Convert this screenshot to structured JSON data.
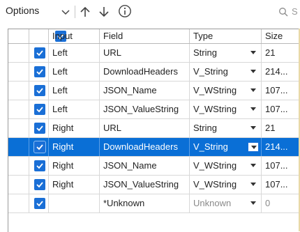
{
  "toolbar": {
    "options_label": "Options",
    "search_text": "S"
  },
  "columns": [
    "Input",
    "Field",
    "Type",
    "Size"
  ],
  "rows": [
    {
      "input": "Left",
      "field": "URL",
      "type": "String",
      "size": "21",
      "checked": true
    },
    {
      "input": "Left",
      "field": "DownloadHeaders",
      "type": "V_String",
      "size": "214...",
      "checked": true
    },
    {
      "input": "Left",
      "field": "JSON_Name",
      "type": "V_WString",
      "size": "107...",
      "checked": true
    },
    {
      "input": "Left",
      "field": "JSON_ValueString",
      "type": "V_WString",
      "size": "107...",
      "checked": true
    },
    {
      "input": "Right",
      "field": "URL",
      "type": "String",
      "size": "21",
      "checked": true
    },
    {
      "input": "Right",
      "field": "DownloadHeaders",
      "type": "V_String",
      "size": "214...",
      "checked": true,
      "selected": true
    },
    {
      "input": "Right",
      "field": "JSON_Name",
      "type": "V_WString",
      "size": "107...",
      "checked": true
    },
    {
      "input": "Right",
      "field": "JSON_ValueString",
      "type": "V_WString",
      "size": "107...",
      "checked": true
    },
    {
      "input": "",
      "field": "*Unknown",
      "type": "Unknown",
      "size": "0",
      "checked": true,
      "muted": true
    }
  ],
  "colors": {
    "accent": "#1a6fd6",
    "selected_row": "#0a6fd6"
  }
}
